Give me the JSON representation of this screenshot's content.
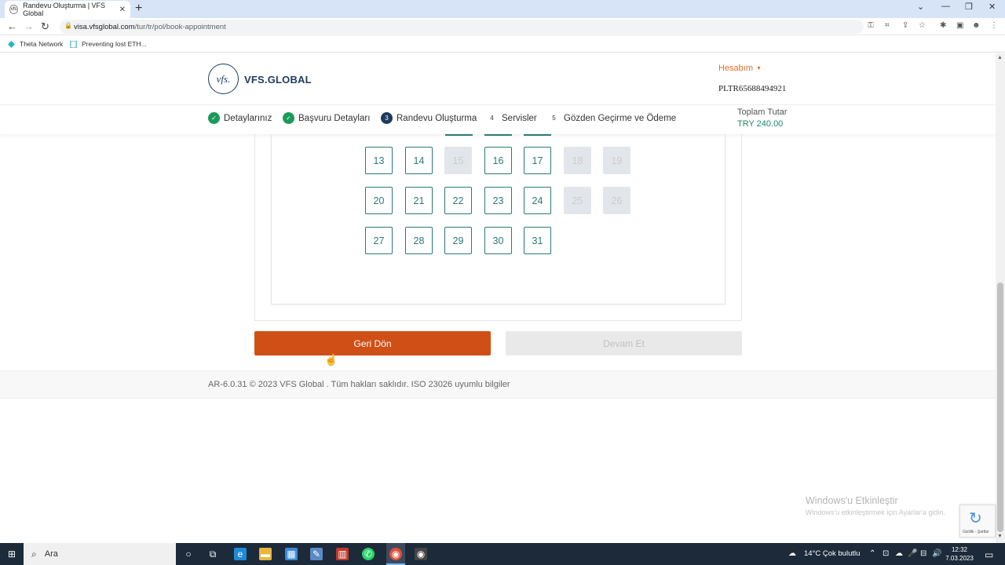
{
  "browser": {
    "tab_title": "Randevu Oluşturma | VFS Global",
    "tab_favicon": "vfs",
    "url_host": "visa.vfsglobal.com",
    "url_path": "/tur/tr/pol/book-appointment",
    "bookmarks": [
      "Theta Network",
      "Preventing lost ETH..."
    ]
  },
  "header": {
    "logo_mark": "vfs.",
    "logo_text": "VFS.GLOBAL",
    "account_label": "Hesabım",
    "reference_number": "PLTR65688494921"
  },
  "steps": [
    {
      "num": "",
      "label": "Detaylarınız",
      "state": "done"
    },
    {
      "num": "",
      "label": "Başvuru Detayları",
      "state": "done"
    },
    {
      "num": "3",
      "label": "Randevu Oluşturma",
      "state": "active"
    },
    {
      "num": "4",
      "label": "Servisler",
      "state": "todo"
    },
    {
      "num": "5",
      "label": "Gözden Geçirme ve Ödeme",
      "state": "todo"
    }
  ],
  "total": {
    "label": "Toplam Tutar",
    "value": "TRY 240.00"
  },
  "calendar": {
    "weeks": [
      [
        {
          "d": "13",
          "available": true
        },
        {
          "d": "14",
          "available": true
        },
        {
          "d": "15",
          "available": false
        },
        {
          "d": "16",
          "available": true
        },
        {
          "d": "17",
          "available": true
        },
        {
          "d": "18",
          "available": false
        },
        {
          "d": "19",
          "available": false
        }
      ],
      [
        {
          "d": "20",
          "available": true
        },
        {
          "d": "21",
          "available": true
        },
        {
          "d": "22",
          "available": true
        },
        {
          "d": "23",
          "available": true
        },
        {
          "d": "24",
          "available": true
        },
        {
          "d": "25",
          "available": false
        },
        {
          "d": "26",
          "available": false
        }
      ],
      [
        {
          "d": "27",
          "available": true
        },
        {
          "d": "28",
          "available": true
        },
        {
          "d": "29",
          "available": true
        },
        {
          "d": "30",
          "available": true
        },
        {
          "d": "31",
          "available": true
        }
      ]
    ],
    "colors": {
      "available": "#2c7a73",
      "unavailable": "#e2e6ea"
    }
  },
  "actions": {
    "back_label": "Geri Dön",
    "continue_label": "Devam Et"
  },
  "footer": {
    "text": "AR-6.0.31 © 2023 VFS Global . Tüm hakları saklıdır. ISO 23026 uyumlu bilgiler"
  },
  "windows_watermark": {
    "title": "Windows'u Etkinleştir",
    "subtitle": "Windows'u etkinleştirmek için Ayarlar'a gidin."
  },
  "recaptcha": {
    "links": "Gizlilik - Şartlar"
  },
  "taskbar": {
    "search_placeholder": "Ara",
    "weather": "14°C  Çok bulutlu",
    "time": "12:32",
    "date": "7.03.2023"
  },
  "colors": {
    "brand_orange": "#d04f16",
    "brand_navy": "#1f3a5f",
    "success_green": "#1a9a5a"
  }
}
